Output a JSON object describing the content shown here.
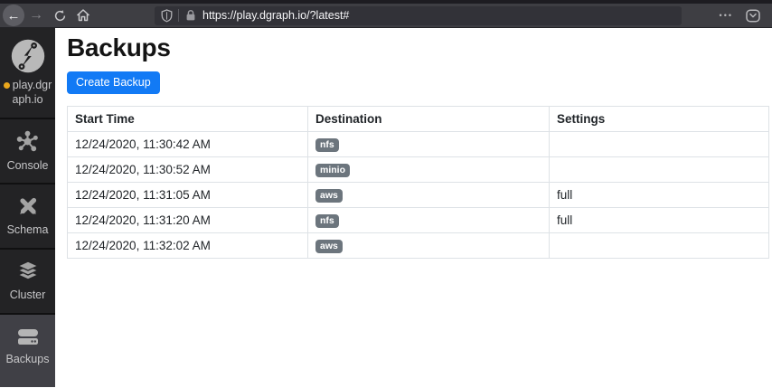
{
  "browser": {
    "url": "https://play.dgraph.io/?latest#",
    "back_glyph": "←",
    "forward_glyph": "→",
    "menu_glyph": "•••"
  },
  "sidebar": {
    "items": [
      {
        "id": "logo",
        "label": "play.dgraph.io",
        "icon": "dgraph-logo-icon",
        "active": false
      },
      {
        "id": "console",
        "label": "Console",
        "icon": "console-graph-icon",
        "active": false
      },
      {
        "id": "schema",
        "label": "Schema",
        "icon": "schema-pencils-icon",
        "active": false
      },
      {
        "id": "cluster",
        "label": "Cluster",
        "icon": "cluster-layers-icon",
        "active": false
      },
      {
        "id": "backups",
        "label": "Backups",
        "icon": "backups-drive-icon",
        "active": true
      }
    ]
  },
  "main": {
    "title": "Backups",
    "create_button_label": "Create Backup",
    "table": {
      "headers": [
        "Start Time",
        "Destination",
        "Settings"
      ],
      "rows": [
        {
          "start_time": "12/24/2020, 11:30:42 AM",
          "destination": "nfs",
          "settings": ""
        },
        {
          "start_time": "12/24/2020, 11:30:52 AM",
          "destination": "minio",
          "settings": ""
        },
        {
          "start_time": "12/24/2020, 11:31:05 AM",
          "destination": "aws",
          "settings": "full"
        },
        {
          "start_time": "12/24/2020, 11:31:20 AM",
          "destination": "nfs",
          "settings": "full"
        },
        {
          "start_time": "12/24/2020, 11:32:02 AM",
          "destination": "aws",
          "settings": ""
        }
      ]
    }
  },
  "colors": {
    "accent_blue": "#127af5",
    "badge_gray": "#6c757d",
    "status_dot": "#e9a61c",
    "toolbar_bg": "#3e3e43",
    "urlbar_bg": "#323238",
    "strip_dark": "#1d1c21"
  }
}
